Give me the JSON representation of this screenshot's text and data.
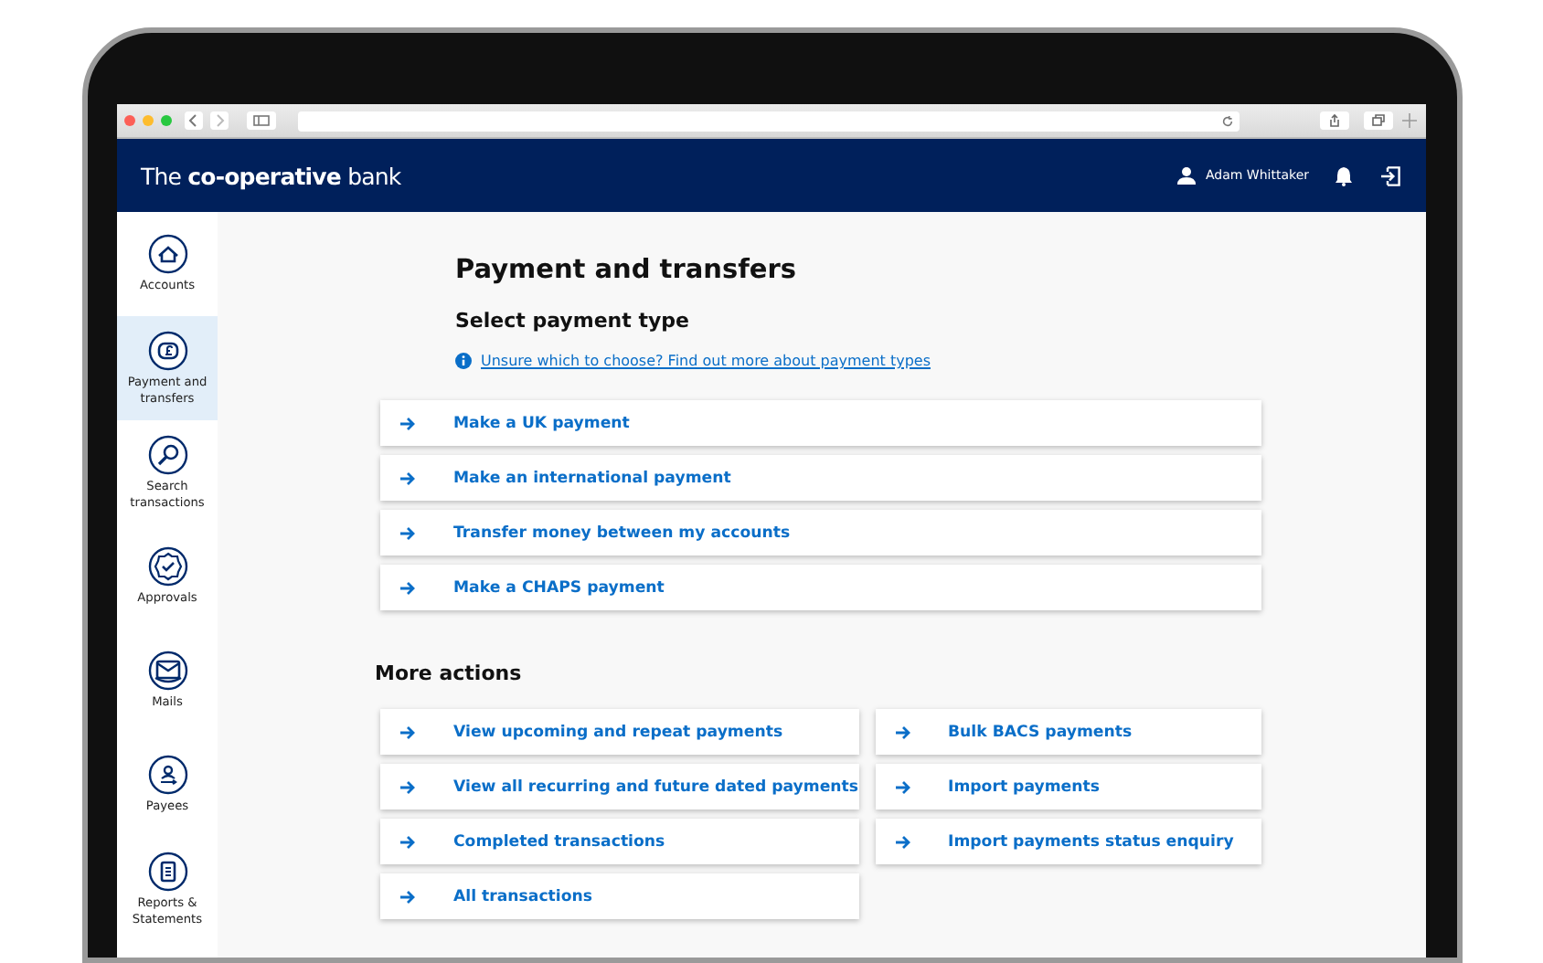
{
  "brand": {
    "logo": "The **co-operative** bank"
  },
  "header": {
    "user": "Adam Whittaker"
  },
  "sidebar": {
    "items": [
      {
        "label": "Accounts",
        "selected": false
      },
      {
        "label": "Payment and transfers",
        "selected": true
      },
      {
        "label": "Search transactions",
        "selected": false
      },
      {
        "label": "Approvals",
        "selected": false
      },
      {
        "label": "Mails",
        "selected": false
      },
      {
        "label": "Payees",
        "selected": false
      },
      {
        "label": "Reports & Statements",
        "selected": false
      }
    ]
  },
  "page": {
    "title": "Payment and transfers",
    "subtitle": "Select payment type",
    "info_link": "Unsure which to choose? Find out more about payment types"
  },
  "payment_types": [
    "Make a UK payment",
    "Make an international payment",
    "Transfer money between my accounts",
    "Make a CHAPS payment"
  ],
  "more_actions": {
    "title": "More actions",
    "left": [
      "View upcoming and repeat payments",
      "View all recurring and future dated payments",
      "Completed transactions",
      "All transactions"
    ],
    "right": [
      "Bulk BACS payments",
      "Import payments",
      "Import payments status enquiry"
    ]
  }
}
